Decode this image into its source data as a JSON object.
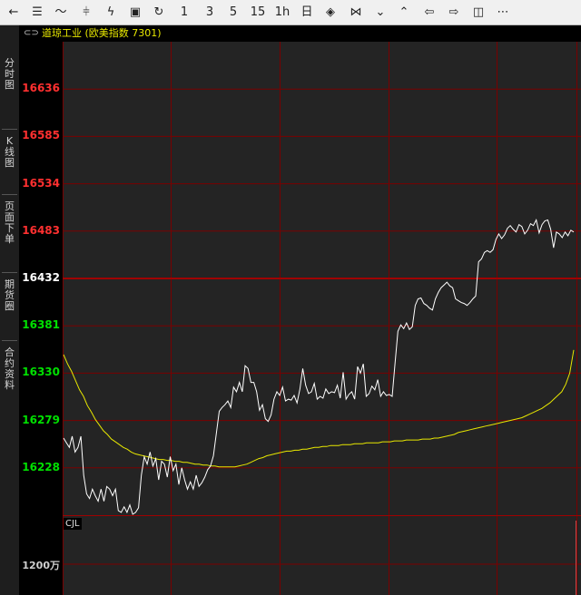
{
  "toolbar": {
    "items": [
      {
        "name": "back-arrow-icon",
        "glyph": "←"
      },
      {
        "name": "list-icon",
        "glyph": "☰"
      },
      {
        "name": "line-chart-icon",
        "glyph": "〜"
      },
      {
        "name": "candlestick-icon",
        "glyph": "⫩"
      },
      {
        "name": "lightning-icon",
        "glyph": "ϟ"
      },
      {
        "name": "save-icon",
        "glyph": "▣"
      },
      {
        "name": "refresh-icon",
        "glyph": "↻"
      },
      {
        "name": "period-1",
        "glyph": "1"
      },
      {
        "name": "period-3",
        "glyph": "3"
      },
      {
        "name": "period-5",
        "glyph": "5"
      },
      {
        "name": "period-15",
        "glyph": "15"
      },
      {
        "name": "period-1h",
        "glyph": "1h"
      },
      {
        "name": "period-day",
        "glyph": "日"
      },
      {
        "name": "zoom-in-icon",
        "glyph": "◈"
      },
      {
        "name": "zoom-out-icon",
        "glyph": "⋈"
      },
      {
        "name": "double-down-icon",
        "glyph": "⌄"
      },
      {
        "name": "double-up-icon",
        "glyph": "⌃"
      },
      {
        "name": "arrow-left-icon",
        "glyph": "⇦"
      },
      {
        "name": "arrow-right-icon",
        "glyph": "⇨"
      },
      {
        "name": "layout-icon",
        "glyph": "◫"
      },
      {
        "name": "more-icon",
        "glyph": "⋯"
      }
    ]
  },
  "sidebar": {
    "tabs": [
      {
        "label": "分时图"
      },
      {
        "label": "K线图"
      },
      {
        "label": "页面下单"
      },
      {
        "label": "期货圈"
      },
      {
        "label": "合约资料"
      }
    ]
  },
  "instrument": {
    "link_icon": "⊂⊃",
    "title": "道琼工业 (欧美指数 7301)"
  },
  "volume": {
    "label": "CJL",
    "axis_label": "1200万"
  },
  "colors": {
    "up": "#ff3030",
    "down": "#00e000",
    "neutral": "#ffffff",
    "grid": "#7a0000",
    "price_line": "#ffffff",
    "avg_line": "#e8e800"
  },
  "chart_data": {
    "type": "line",
    "y_ticks": [
      16636,
      16585,
      16534,
      16483,
      16432,
      16381,
      16330,
      16279,
      16228
    ],
    "ylim": [
      16177,
      16687
    ],
    "reference_price": 16432,
    "series": [
      {
        "values": [
          16260,
          16255,
          16250,
          16262,
          16245,
          16250,
          16262,
          16220,
          16200,
          16195,
          16205,
          16198,
          16192,
          16205,
          16192,
          16208,
          16205,
          16198,
          16205,
          16182,
          16180,
          16186,
          16180,
          16188,
          16178,
          16180,
          16185,
          16220,
          16240,
          16232,
          16245,
          16230,
          16238,
          16215,
          16235,
          16232,
          16218,
          16240,
          16225,
          16232,
          16210,
          16228,
          16215,
          16205,
          16213,
          16205,
          16220,
          16208,
          16212,
          16218,
          16226,
          16230,
          16241,
          16265,
          16289,
          16293,
          16296,
          16300,
          16293,
          16315,
          16310,
          16320,
          16310,
          16338,
          16335,
          16320,
          16320,
          16310,
          16290,
          16296,
          16281,
          16278,
          16285,
          16302,
          16310,
          16306,
          16315,
          16300,
          16302,
          16301,
          16306,
          16298,
          16313,
          16335,
          16317,
          16308,
          16310,
          16319,
          16302,
          16305,
          16303,
          16313,
          16308,
          16310,
          16309,
          16317,
          16303,
          16331,
          16302,
          16307,
          16310,
          16302,
          16337,
          16330,
          16340,
          16305,
          16308,
          16316,
          16312,
          16323,
          16305,
          16310,
          16306,
          16307,
          16305,
          16340,
          16375,
          16382,
          16378,
          16384,
          16377,
          16380,
          16403,
          16410,
          16411,
          16405,
          16403,
          16400,
          16398,
          16410,
          16417,
          16422,
          16425,
          16428,
          16424,
          16422,
          16410,
          16408,
          16406,
          16405,
          16403,
          16406,
          16410,
          16413,
          16450,
          16453,
          16460,
          16462,
          16460,
          16463,
          16474,
          16480,
          16475,
          16479,
          16486,
          16489,
          16485,
          16482,
          16490,
          16488,
          16480,
          16484,
          16491,
          16489,
          16495,
          16481,
          16490,
          16494,
          16495,
          16485,
          16465,
          16482,
          16480,
          16476,
          16482,
          16478,
          16484,
          16482
        ]
      },
      {
        "values": [
          16350,
          16340,
          16332,
          16322,
          16312,
          16305,
          16295,
          16288,
          16280,
          16274,
          16268,
          16264,
          16259,
          16256,
          16253,
          16250,
          16248,
          16245,
          16243,
          16242,
          16241,
          16240,
          16239,
          16238,
          16237,
          16237,
          16236,
          16236,
          16235,
          16235,
          16234,
          16234,
          16233,
          16232,
          16232,
          16231,
          16231,
          16230,
          16230,
          16229,
          16229,
          16229,
          16229,
          16229,
          16230,
          16231,
          16232,
          16234,
          16236,
          16238,
          16239,
          16241,
          16242,
          16243,
          16244,
          16245,
          16246,
          16246,
          16247,
          16247,
          16248,
          16248,
          16249,
          16250,
          16250,
          16251,
          16251,
          16252,
          16252,
          16252,
          16253,
          16253,
          16253,
          16254,
          16254,
          16254,
          16255,
          16255,
          16255,
          16255,
          16256,
          16256,
          16256,
          16257,
          16257,
          16257,
          16258,
          16258,
          16258,
          16258,
          16259,
          16259,
          16259,
          16260,
          16260,
          16261,
          16262,
          16263,
          16264,
          16266,
          16267,
          16268,
          16269,
          16270,
          16271,
          16272,
          16273,
          16274,
          16275,
          16276,
          16277,
          16278,
          16279,
          16280,
          16281,
          16282,
          16284,
          16286,
          16288,
          16290,
          16292,
          16295,
          16298,
          16302,
          16306,
          16310,
          16318,
          16330,
          16355
        ]
      }
    ]
  }
}
